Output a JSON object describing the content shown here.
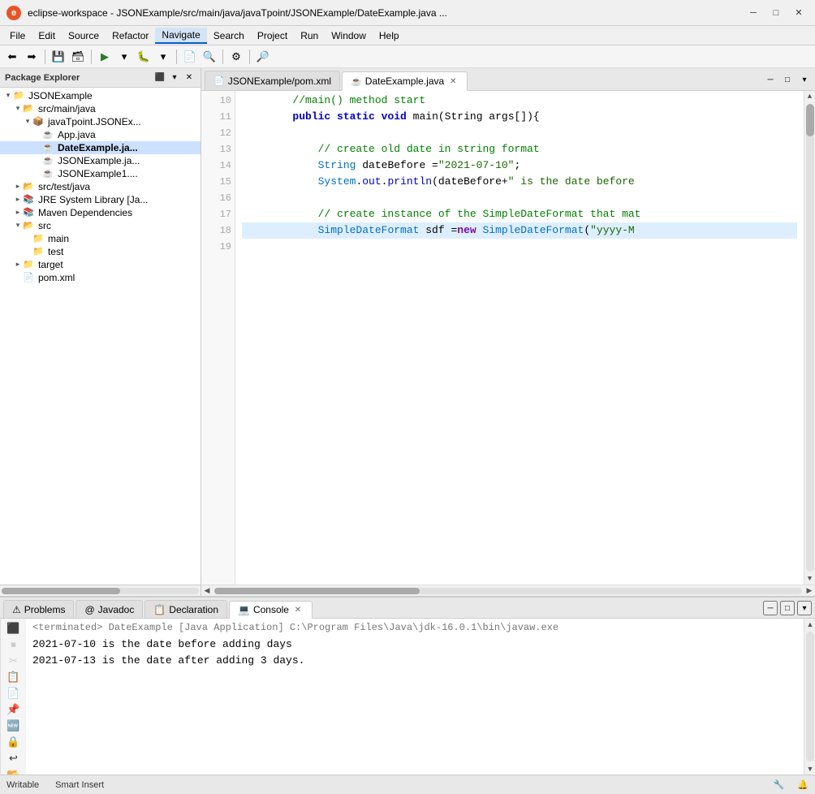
{
  "titleBar": {
    "icon": "E",
    "title": "eclipse-workspace - JSONExample/src/main/java/javaTpoint/JSONExample/DateExample.java ...",
    "minBtn": "─",
    "maxBtn": "□",
    "closeBtn": "✕"
  },
  "menuBar": {
    "items": [
      "File",
      "Edit",
      "Source",
      "Refactor",
      "Navigate",
      "Search",
      "Project",
      "Run",
      "Window",
      "Help"
    ]
  },
  "toolbar": {
    "buttons": [
      "⬅",
      "⮂",
      "💾",
      "▶",
      "⏸",
      "⏹",
      "🔧",
      "🔍",
      "⚙",
      "📋",
      "📄",
      "🗑",
      "✂",
      "📌",
      "🔎",
      "⬆",
      "⬇"
    ]
  },
  "packageExplorer": {
    "title": "Package Explorer",
    "tree": [
      {
        "id": "json-example",
        "label": "JSONExample",
        "indent": 0,
        "arrow": "▾",
        "icon": "📁",
        "type": "project"
      },
      {
        "id": "src-main-java",
        "label": "src/main/java",
        "indent": 1,
        "arrow": "▾",
        "icon": "📂",
        "type": "folder"
      },
      {
        "id": "javatpoint",
        "label": "javaTpoint.JSONEx...",
        "indent": 2,
        "arrow": "▾",
        "icon": "📦",
        "type": "package"
      },
      {
        "id": "app-java",
        "label": "App.java",
        "indent": 3,
        "arrow": " ",
        "icon": "☕",
        "type": "file"
      },
      {
        "id": "date-example",
        "label": "DateExample.ja...",
        "indent": 3,
        "arrow": " ",
        "icon": "☕",
        "type": "file",
        "selected": true
      },
      {
        "id": "json-example-file",
        "label": "JSONExample.ja...",
        "indent": 3,
        "arrow": " ",
        "icon": "☕",
        "type": "file"
      },
      {
        "id": "json-example1",
        "label": "JSONExample1....",
        "indent": 3,
        "arrow": " ",
        "icon": "☕",
        "type": "file"
      },
      {
        "id": "src-test-java",
        "label": "src/test/java",
        "indent": 1,
        "arrow": "▸",
        "icon": "📂",
        "type": "folder"
      },
      {
        "id": "jre-system",
        "label": "JRE System Library [Ja...",
        "indent": 1,
        "arrow": "▸",
        "icon": "📚",
        "type": "library"
      },
      {
        "id": "maven-deps",
        "label": "Maven Dependencies",
        "indent": 1,
        "arrow": "▸",
        "icon": "📚",
        "type": "library"
      },
      {
        "id": "src",
        "label": "src",
        "indent": 1,
        "arrow": "▾",
        "icon": "📂",
        "type": "folder"
      },
      {
        "id": "main",
        "label": "main",
        "indent": 2,
        "arrow": " ",
        "icon": "📁",
        "type": "folder"
      },
      {
        "id": "test",
        "label": "test",
        "indent": 2,
        "arrow": " ",
        "icon": "📁",
        "type": "folder"
      },
      {
        "id": "target",
        "label": "target",
        "indent": 1,
        "arrow": "▸",
        "icon": "📁",
        "type": "folder"
      },
      {
        "id": "pom-xml",
        "label": "pom.xml",
        "indent": 1,
        "arrow": " ",
        "icon": "📄",
        "type": "file"
      }
    ]
  },
  "editorTabs": {
    "tabs": [
      {
        "id": "pom-tab",
        "label": "JSONExample/pom.xml",
        "icon": "📄",
        "active": false
      },
      {
        "id": "date-tab",
        "label": "DateExample.java",
        "icon": "☕",
        "active": true
      }
    ],
    "ctrls": [
      "▾",
      "□",
      "✕"
    ]
  },
  "codeEditor": {
    "lines": [
      {
        "num": "10",
        "content": "comment_main_start"
      },
      {
        "num": "11",
        "content": "public_static_void"
      },
      {
        "num": "12",
        "content": "blank"
      },
      {
        "num": "13",
        "content": "comment_old_date"
      },
      {
        "num": "14",
        "content": "string_date_before"
      },
      {
        "num": "15",
        "content": "system_out_println"
      },
      {
        "num": "16",
        "content": "blank"
      },
      {
        "num": "17",
        "content": "comment_instance"
      },
      {
        "num": "18",
        "content": "simple_date_format",
        "highlighted": true
      },
      {
        "num": "19",
        "content": "blank"
      }
    ],
    "rawLines": [
      {
        "num": "10",
        "text": "//main() method start"
      },
      {
        "num": "11",
        "text": "    public static void main(String args[]){"
      },
      {
        "num": "12",
        "text": ""
      },
      {
        "num": "13",
        "text": "        // create old date in string format"
      },
      {
        "num": "14",
        "text": "        String dateBefore = \"2021-07-10\";"
      },
      {
        "num": "15",
        "text": "        System.out.println(dateBefore+\" is the date before"
      },
      {
        "num": "16",
        "text": ""
      },
      {
        "num": "17",
        "text": "        // create instance of the SimpleDateFormat that mat"
      },
      {
        "num": "18",
        "text": "        SimpleDateFormat sdf = new SimpleDateFormat(\"yyyy-M"
      },
      {
        "num": "19",
        "text": ""
      }
    ]
  },
  "bottomPanel": {
    "tabs": [
      {
        "id": "problems-tab",
        "label": "Problems",
        "icon": "⚠"
      },
      {
        "id": "javadoc-tab",
        "label": "Javadoc",
        "icon": "@"
      },
      {
        "id": "declaration-tab",
        "label": "Declaration",
        "icon": "📋"
      },
      {
        "id": "console-tab",
        "label": "Console",
        "icon": "💻",
        "active": true,
        "closeable": true
      }
    ],
    "console": {
      "terminated": "<terminated> DateExample [Java Application] C:\\Program Files\\Java\\jdk-16.0.1\\bin\\javaw.exe",
      "line1": "2021-07-10 is the date before adding days",
      "line2": "2021-07-13 is the date after adding 3 days."
    }
  },
  "statusBar": {
    "writable": "Writable",
    "smartInsert": "Smart Insert",
    "icons": [
      "🔧",
      "🔔"
    ]
  }
}
